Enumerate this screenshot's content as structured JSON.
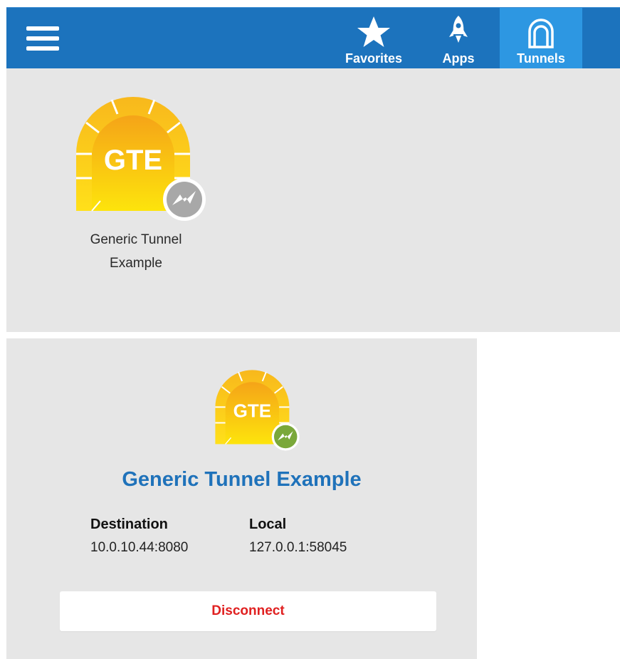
{
  "header": {
    "menu_icon": "hamburger-icon",
    "nav": [
      {
        "label": "Favorites",
        "icon": "star-icon"
      },
      {
        "label": "Apps",
        "icon": "rocket-icon"
      },
      {
        "label": "Tunnels",
        "icon": "tunnel-icon",
        "active": true
      }
    ]
  },
  "tunnel_list": {
    "items": [
      {
        "badge_text": "GTE",
        "name_line1": "Generic Tunnel",
        "name_line2": "Example",
        "status": "disconnected",
        "status_color": "#a8a8a8"
      }
    ]
  },
  "tunnel_detail": {
    "badge_text": "GTE",
    "status": "connected",
    "status_color": "#7aa83a",
    "title": "Generic Tunnel Example",
    "destination_label": "Destination",
    "destination_value": "10.0.10.44:8080",
    "local_label": "Local",
    "local_value": "127.0.0.1:58045",
    "disconnect_label": "Disconnect"
  },
  "colors": {
    "header_bg": "#1c73bd",
    "active_tab": "#2d97e2",
    "panel_bg": "#e6e6e6",
    "title_blue": "#1f72ba",
    "danger": "#e02020"
  }
}
